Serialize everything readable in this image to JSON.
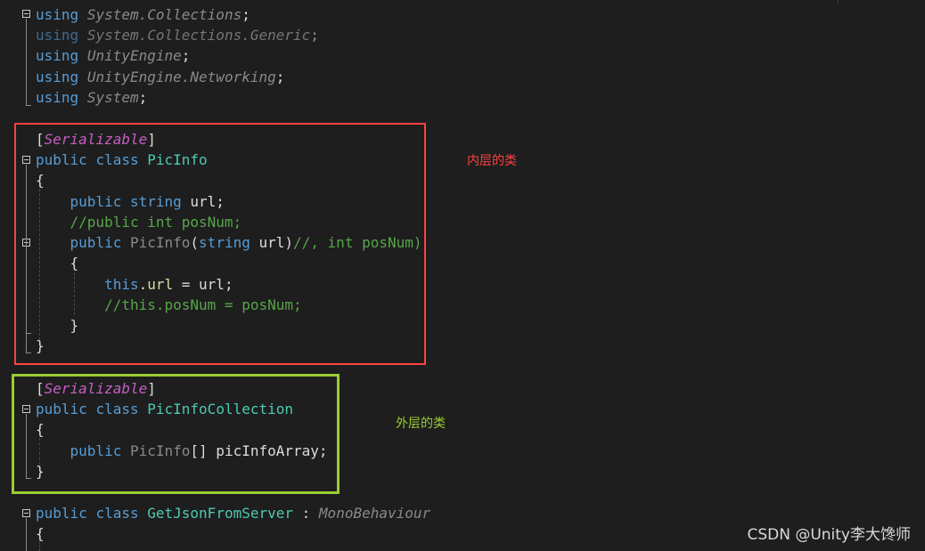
{
  "editor": {
    "colors": {
      "background": "#1e1e1e",
      "keyword": "#569cd6",
      "type": "#4ec9b0",
      "comment": "#57a64a",
      "attribute": "#c55fc5",
      "namespace": "#8a8a8a",
      "plain": "#dcdcdc"
    },
    "lines": [
      {
        "id": "l1",
        "segments": [
          {
            "t": "using",
            "c": "kw"
          },
          {
            "t": " "
          },
          {
            "t": "System.Collections",
            "c": "ns"
          },
          {
            "t": ";"
          }
        ]
      },
      {
        "id": "l2",
        "segments": [
          {
            "t": "using",
            "c": "kwdim"
          },
          {
            "t": " "
          },
          {
            "t": "System.Collections.Generic",
            "c": "nsdim"
          },
          {
            "t": ";",
            "c": "dim"
          }
        ]
      },
      {
        "id": "l3",
        "segments": [
          {
            "t": "using",
            "c": "kw"
          },
          {
            "t": " "
          },
          {
            "t": "UnityEngine",
            "c": "ns"
          },
          {
            "t": ";"
          }
        ]
      },
      {
        "id": "l4",
        "segments": [
          {
            "t": "using",
            "c": "kw"
          },
          {
            "t": " "
          },
          {
            "t": "UnityEngine.Networking",
            "c": "ns"
          },
          {
            "t": ";"
          }
        ]
      },
      {
        "id": "l5",
        "segments": [
          {
            "t": "using",
            "c": "kw"
          },
          {
            "t": " "
          },
          {
            "t": "System",
            "c": "ns"
          },
          {
            "t": ";"
          }
        ]
      },
      {
        "id": "l6",
        "segments": [
          {
            "t": "["
          },
          {
            "t": "Serializable",
            "c": "attr"
          },
          {
            "t": "]"
          }
        ]
      },
      {
        "id": "l7",
        "segments": [
          {
            "t": "public",
            "c": "kw"
          },
          {
            "t": " "
          },
          {
            "t": "class",
            "c": "kw"
          },
          {
            "t": " "
          },
          {
            "t": "PicInfo",
            "c": "type"
          }
        ]
      },
      {
        "id": "l8",
        "segments": [
          {
            "t": "{"
          }
        ]
      },
      {
        "id": "l9",
        "segments": [
          {
            "t": "    "
          },
          {
            "t": "public",
            "c": "kw"
          },
          {
            "t": " "
          },
          {
            "t": "string",
            "c": "kw"
          },
          {
            "t": " url;"
          }
        ]
      },
      {
        "id": "l10",
        "segments": [
          {
            "t": "    "
          },
          {
            "t": "//public int posNum;",
            "c": "cm"
          }
        ]
      },
      {
        "id": "l11",
        "segments": [
          {
            "t": "    "
          },
          {
            "t": "public",
            "c": "kw"
          },
          {
            "t": " "
          },
          {
            "t": "PicInfo",
            "c": "unused"
          },
          {
            "t": "("
          },
          {
            "t": "string",
            "c": "kw"
          },
          {
            "t": " url)"
          },
          {
            "t": "//, int posNum)",
            "c": "cm"
          }
        ]
      },
      {
        "id": "l12",
        "segments": [
          {
            "t": "    {"
          }
        ]
      },
      {
        "id": "l13",
        "segments": [
          {
            "t": "        "
          },
          {
            "t": "this",
            "c": "kw"
          },
          {
            "t": "."
          },
          {
            "t": "url",
            "c": "field"
          },
          {
            "t": " = url;"
          }
        ]
      },
      {
        "id": "l14",
        "segments": [
          {
            "t": "        "
          },
          {
            "t": "//this.posNum = posNum;",
            "c": "cm"
          }
        ]
      },
      {
        "id": "l15",
        "segments": [
          {
            "t": "    }"
          }
        ]
      },
      {
        "id": "l16",
        "segments": [
          {
            "t": "}"
          }
        ]
      },
      {
        "id": "l17",
        "segments": [
          {
            "t": "["
          },
          {
            "t": "Serializable",
            "c": "attr"
          },
          {
            "t": "]"
          }
        ]
      },
      {
        "id": "l18",
        "segments": [
          {
            "t": "public",
            "c": "kw"
          },
          {
            "t": " "
          },
          {
            "t": "class",
            "c": "kw"
          },
          {
            "t": " "
          },
          {
            "t": "PicInfoCollection",
            "c": "type"
          }
        ]
      },
      {
        "id": "l19",
        "segments": [
          {
            "t": "{"
          }
        ]
      },
      {
        "id": "l20",
        "segments": [
          {
            "t": "    "
          },
          {
            "t": "public",
            "c": "kw"
          },
          {
            "t": " "
          },
          {
            "t": "PicInfo",
            "c": "unused"
          },
          {
            "t": "[] picInfoArray;"
          }
        ]
      },
      {
        "id": "l21",
        "segments": [
          {
            "t": "}"
          }
        ]
      },
      {
        "id": "l22",
        "segments": [
          {
            "t": "public",
            "c": "kw"
          },
          {
            "t": " "
          },
          {
            "t": "class",
            "c": "kw"
          },
          {
            "t": " "
          },
          {
            "t": "GetJsonFromServer",
            "c": "type"
          },
          {
            "t": " : "
          },
          {
            "t": "MonoBehaviour",
            "c": "ns"
          }
        ]
      },
      {
        "id": "l23",
        "segments": [
          {
            "t": "{"
          }
        ]
      }
    ]
  },
  "annotations": {
    "inner": {
      "label": "内层的类",
      "color": "#ff4040"
    },
    "outer": {
      "label": "外层的类",
      "color": "#9acd32"
    }
  },
  "watermark": "CSDN @Unity李大馋师"
}
